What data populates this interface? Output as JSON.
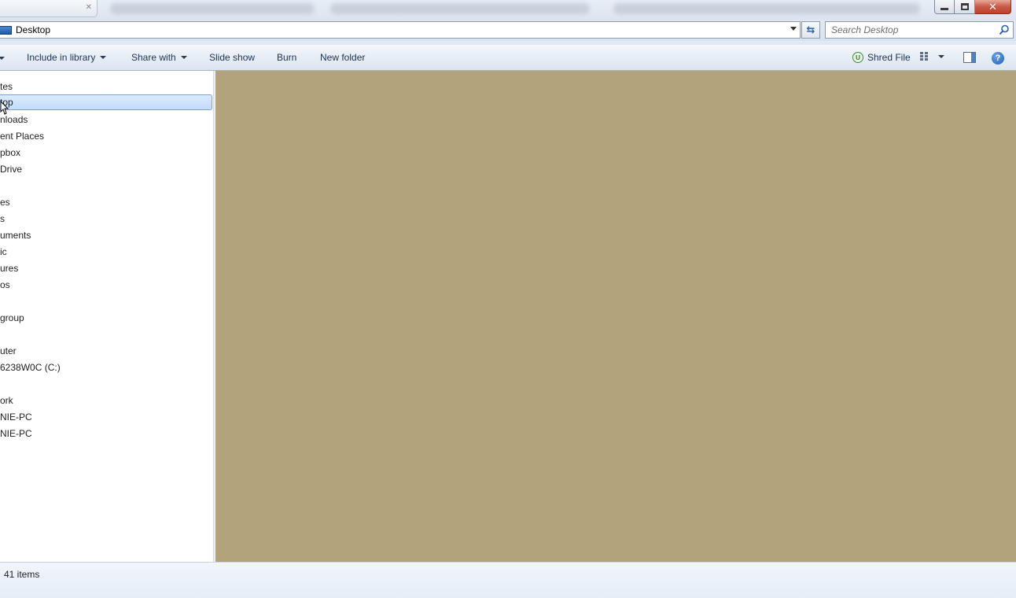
{
  "window": {
    "close_glyph": "✕"
  },
  "address_bar": {
    "location": "Desktop",
    "refresh_glyph": "⇆"
  },
  "search": {
    "placeholder": "Search Desktop"
  },
  "command_bar": {
    "include_in_library": "Include in library",
    "share_with": "Share with",
    "slide_show": "Slide show",
    "burn": "Burn",
    "new_folder": "New folder",
    "shred_file": "Shred File",
    "shred_icon_letter": "U",
    "help_glyph": "?"
  },
  "nav_pane": {
    "items": [
      {
        "label": "tes"
      },
      {
        "label": "top"
      },
      {
        "label": "nloads"
      },
      {
        "label": "ent Places"
      },
      {
        "label": "pbox"
      },
      {
        "label": "Drive"
      },
      {
        "label": "es"
      },
      {
        "label": "s"
      },
      {
        "label": "uments"
      },
      {
        "label": "ic"
      },
      {
        "label": "ures"
      },
      {
        "label": "os"
      },
      {
        "label": "group"
      },
      {
        "label": "uter"
      },
      {
        "label": "6238W0C (C:)"
      },
      {
        "label": "ork"
      },
      {
        "label": "NIE-PC"
      },
      {
        "label": "NIE-PC"
      }
    ],
    "selected_index": 1
  },
  "status_bar": {
    "item_count": "41 items"
  },
  "colors": {
    "content_background": "#b2a37b",
    "selection": "#c1dcfa",
    "close_button": "#c75a45"
  }
}
